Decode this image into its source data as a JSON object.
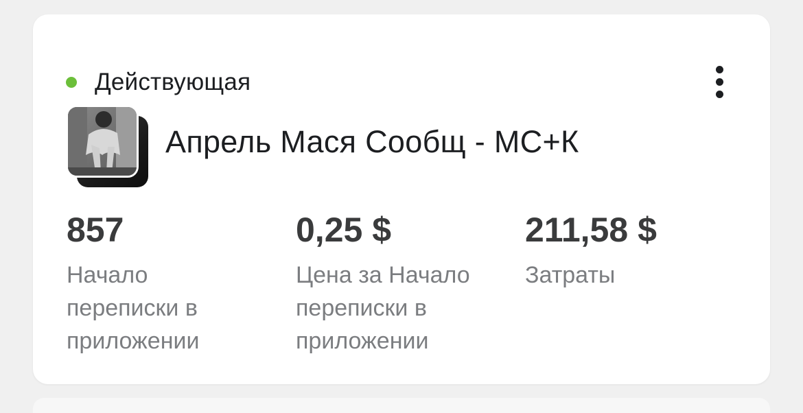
{
  "status": {
    "label": "Действующая",
    "color": "#6cbf3a"
  },
  "menu": {
    "icon": "more-vertical-icon"
  },
  "campaign": {
    "name": "Апрель Мася Сообщ - МС+К",
    "thumbnail": "campaign-thumbnail-image"
  },
  "metrics": [
    {
      "value": "857",
      "label": "Начало переписки в приложении"
    },
    {
      "value": "0,25 $",
      "label": "Цена за Начало переписки в приложении"
    },
    {
      "value": "211,58 $",
      "label": "Затраты"
    }
  ]
}
